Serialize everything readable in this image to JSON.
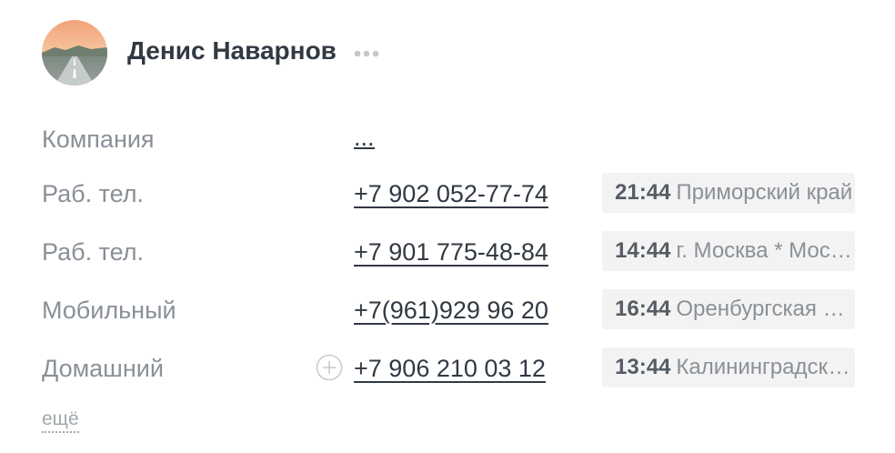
{
  "contact": {
    "name": "Денис Наварнов",
    "avatar_icon": "avatar-road-photo",
    "more_icon": "more-dots-icon"
  },
  "fields": [
    {
      "label": "Компания",
      "value": "..."
    },
    {
      "label": "Раб. тел.",
      "value": "+7 902 052-77-74",
      "time": "21:44",
      "region": "Приморский край"
    },
    {
      "label": "Раб. тел.",
      "value": "+7 901 775-48-84",
      "time": "14:44",
      "region": "г. Москва * Московская область"
    },
    {
      "label": "Мобильный",
      "value": "+7(961)929 96 20",
      "time": "16:44",
      "region": "Оренбургская область"
    },
    {
      "label": "Домашний",
      "value": "+7 906 210 03 12",
      "time": "13:44",
      "region": "Калининградская область",
      "add_icon": "plus-circle-icon"
    }
  ],
  "more_link": "ещё",
  "colors": {
    "text": "#313942",
    "label": "#8a9097",
    "chip_bg": "#f3f3f3"
  }
}
